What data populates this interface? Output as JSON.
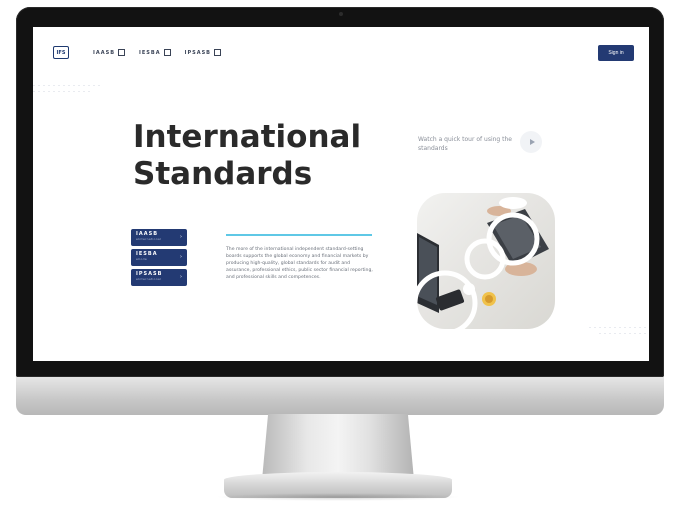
{
  "logo": {
    "text": "IFS"
  },
  "nav": {
    "links": [
      {
        "label": "IAASB"
      },
      {
        "label": "IESBA"
      },
      {
        "label": "IPSASB"
      }
    ]
  },
  "signin": {
    "label": "Sign in"
  },
  "hero": {
    "title_line1": "International",
    "title_line2": "Standards",
    "tour_text": "Watch a quick tour of using the standards"
  },
  "boards": [
    {
      "name": "IAASB",
      "sub": "eInternational"
    },
    {
      "name": "IESBA",
      "sub": "eCode"
    },
    {
      "name": "IPSASB",
      "sub": "eInternational"
    }
  ],
  "description": "The more of the international independent standard-setting boards supports the global economy and financial markets by producing high-quality, global standards for audit and assurance, professional ethics, public sector financial reporting, and professional skills and competences.",
  "colors": {
    "primary": "#233a73",
    "accent": "#5fc8e6",
    "title": "#2a2a2a",
    "muted_text": "#8a8f99"
  },
  "icons": {
    "external_link": "external-link-icon",
    "play": "play-icon",
    "arrow": "chevron-right-icon"
  }
}
